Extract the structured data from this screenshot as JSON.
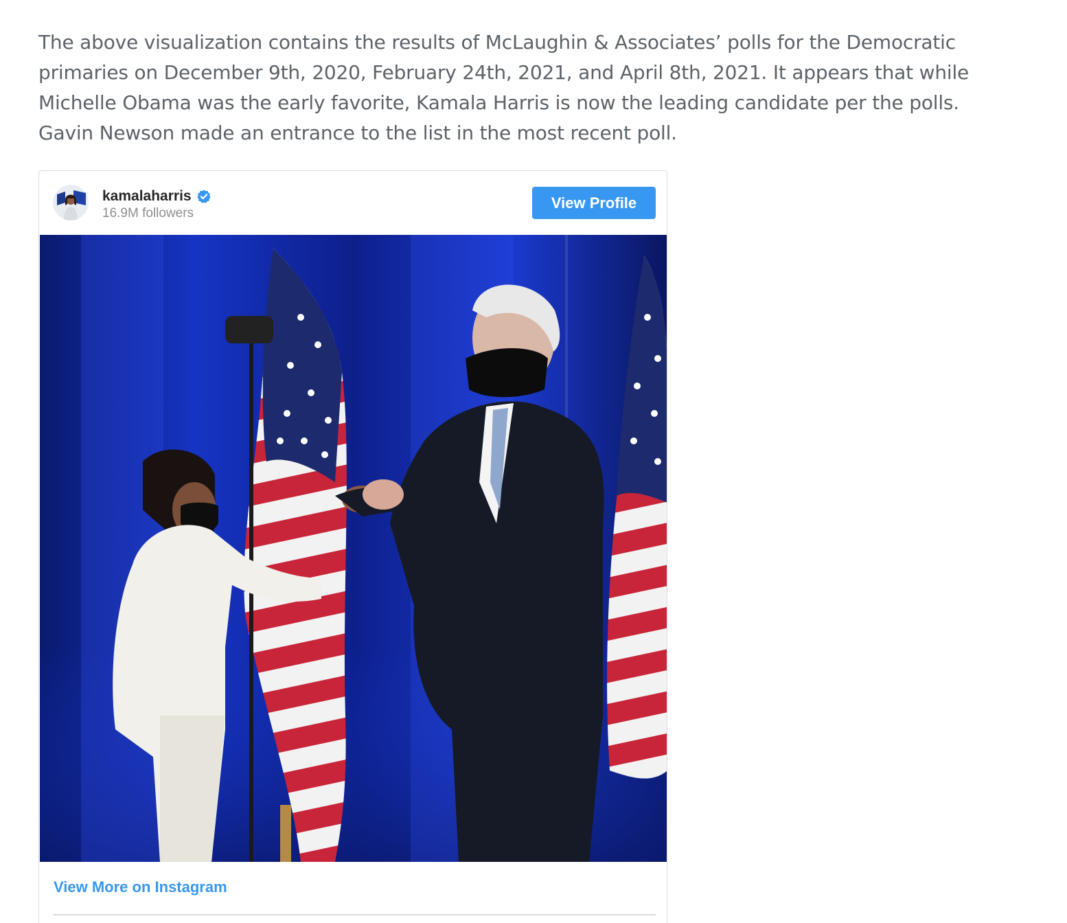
{
  "article": {
    "paragraph": "The above visualization contains the results of McLaughin & Associates’ polls for the Democratic primaries on December 9th, 2020, February 24th, 2021, and April 8th, 2021. It appears that while Michelle Obama was the early favorite, Kamala Harris is now the leading candidate per the polls. Gavin Newson made an entrance to the list in the most recent poll."
  },
  "instagram_embed": {
    "username": "kamalaharris",
    "verified": true,
    "followers": "16.9M followers",
    "view_profile_label": "View Profile",
    "view_more_label": "View More on Instagram",
    "photo_icon": "photo-icon",
    "avatar_icon": "avatar-icon",
    "verified_icon": "verified-badge-icon"
  },
  "colors": {
    "body_text": "#5c6268",
    "instagram_blue": "#3897f0",
    "username_text": "#262626",
    "muted_text": "#8e8e8e",
    "border": "#dbdbdb"
  }
}
